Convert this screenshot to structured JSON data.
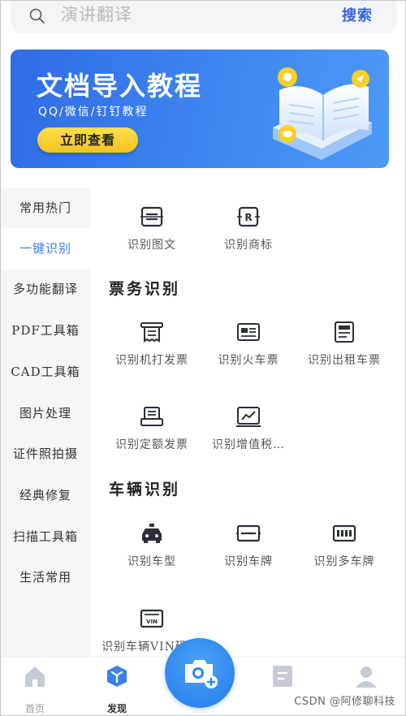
{
  "search": {
    "placeholder": "演讲翻译",
    "button_label": "搜索",
    "icon": "search-icon"
  },
  "banner": {
    "title": "文档导入教程",
    "subtitle": "QQ/微信/钉钉教程",
    "cta_label": "立即查看",
    "colors": {
      "background": "#3b7ef0",
      "cta": "#f9cf2a"
    }
  },
  "sidebar": {
    "items": [
      {
        "label": "常用热门"
      },
      {
        "label": "一键识别"
      },
      {
        "label": "多功能翻译"
      },
      {
        "label": "PDF工具箱"
      },
      {
        "label": "CAD工具箱"
      },
      {
        "label": "图片处理"
      },
      {
        "label": "证件照拍摄"
      },
      {
        "label": "经典修复"
      },
      {
        "label": "扫描工具箱"
      },
      {
        "label": "生活常用"
      }
    ],
    "active_label": "一键识别",
    "active_color": "#3b7ff0"
  },
  "main": {
    "top_tools": [
      {
        "label": "识别图文",
        "icon": "image-text-scan-icon"
      },
      {
        "label": "识别商标",
        "icon": "trademark-scan-icon"
      }
    ],
    "sections": [
      {
        "title": "票务识别",
        "tools": [
          {
            "label": "识别机打发票",
            "icon": "printed-invoice-icon"
          },
          {
            "label": "识别火车票",
            "icon": "train-ticket-icon"
          },
          {
            "label": "识别出租车票",
            "icon": "taxi-receipt-icon"
          },
          {
            "label": "识别定额发票",
            "icon": "quota-invoice-icon"
          },
          {
            "label": "识别增值税…",
            "icon": "vat-invoice-icon"
          }
        ]
      },
      {
        "title": "车辆识别",
        "tools": [
          {
            "label": "识别车型",
            "icon": "car-model-icon"
          },
          {
            "label": "识别车牌",
            "icon": "license-plate-icon"
          },
          {
            "label": "识别多车牌",
            "icon": "multi-plate-icon"
          },
          {
            "label": "识别车辆VIN码",
            "icon": "vin-icon"
          }
        ]
      }
    ]
  },
  "bottom_nav": {
    "items": [
      {
        "label": "首页",
        "icon": "home-icon"
      },
      {
        "label": "发现",
        "icon": "discover-cube-icon",
        "active": true
      },
      {
        "label": "",
        "icon": "document-icon"
      },
      {
        "label": "",
        "icon": "profile-icon"
      }
    ],
    "camera_icon": "camera-add-icon"
  },
  "watermark": "CSDN @阿修聊科技"
}
